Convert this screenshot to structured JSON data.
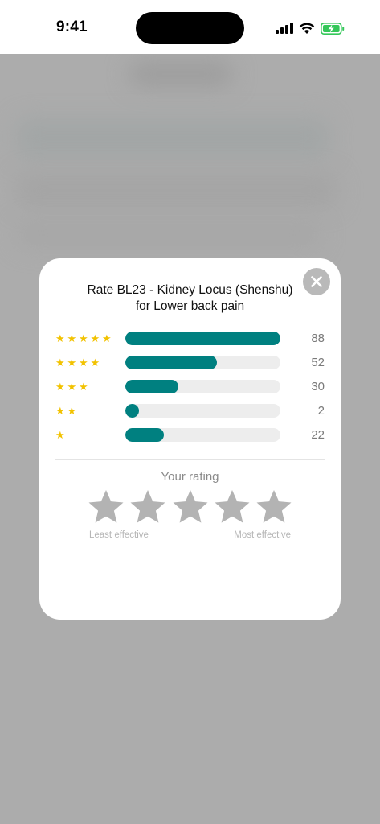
{
  "status_bar": {
    "time": "9:41",
    "icons": [
      "cellular-signal-icon",
      "wifi-icon",
      "battery-charging-icon"
    ]
  },
  "modal": {
    "title": "Rate BL23 - Kidney Locus (Shenshu) for Lower back pain",
    "close_icon": "close-icon",
    "distribution": [
      {
        "stars": 5,
        "count": "88",
        "fraction": 1.0
      },
      {
        "stars": 4,
        "count": "52",
        "fraction": 0.59
      },
      {
        "stars": 3,
        "count": "30",
        "fraction": 0.34
      },
      {
        "stars": 2,
        "count": "2",
        "fraction": 0.09
      },
      {
        "stars": 1,
        "count": "22",
        "fraction": 0.25
      }
    ],
    "your_rating_label": "Your rating",
    "your_rating_value": 0,
    "scale_min_label": "Least effective",
    "scale_max_label": "Most effective"
  },
  "colors": {
    "accent": "#008080",
    "star_filled": "#F2C200",
    "star_empty": "#B3B3B3",
    "battery_charging": "#34C759"
  }
}
